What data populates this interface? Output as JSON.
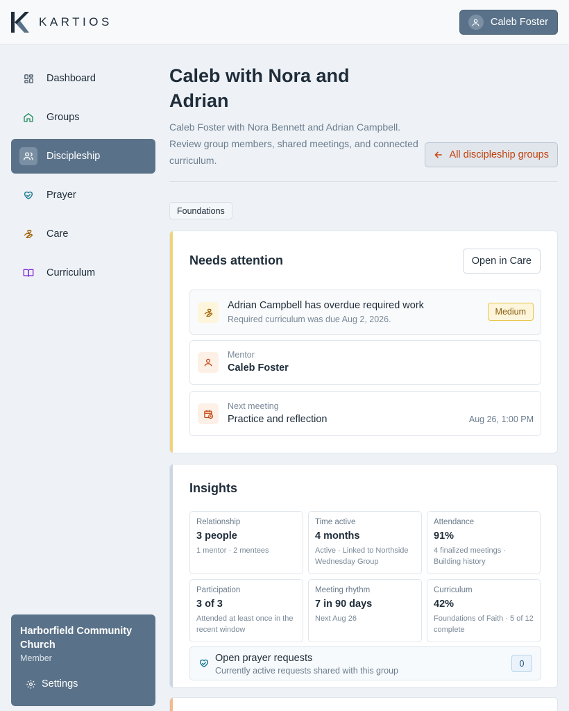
{
  "brand": {
    "name": "KARTIOS"
  },
  "user": {
    "name": "Caleb Foster"
  },
  "sidebar": {
    "items": [
      {
        "label": "Dashboard",
        "icon": "dashboard-icon"
      },
      {
        "label": "Groups",
        "icon": "home-icon"
      },
      {
        "label": "Discipleship",
        "icon": "users-icon",
        "active": true
      },
      {
        "label": "Prayer",
        "icon": "heart-hands-icon"
      },
      {
        "label": "Care",
        "icon": "hand-heart-icon"
      },
      {
        "label": "Curriculum",
        "icon": "book-icon"
      }
    ],
    "church": {
      "name": "Harborfield Community Church",
      "role": "Member",
      "settings_label": "Settings"
    }
  },
  "header": {
    "title": "Caleb with Nora and Adrian",
    "subtitle": "Caleb Foster with Nora Bennett and Adrian Campbell. Review group members, shared meetings, and connected curriculum.",
    "back_label": "All discipleship groups",
    "tag": "Foundations"
  },
  "attention": {
    "title": "Needs attention",
    "open_label": "Open in Care",
    "alert": {
      "title": "Adrian Campbell has overdue required work",
      "detail": "Required curriculum was due Aug 2, 2026.",
      "badge": "Medium"
    },
    "mentor": {
      "label": "Mentor",
      "value": "Caleb Foster"
    },
    "meeting": {
      "label": "Next meeting",
      "value": "Practice and reflection",
      "date": "Aug 26, 1:00 PM"
    }
  },
  "insights": {
    "title": "Insights",
    "tiles": [
      {
        "label": "Relationship",
        "value": "3 people",
        "detail": "1 mentor · 2 mentees"
      },
      {
        "label": "Time active",
        "value": "4 months",
        "detail": "Active · Linked to Northside Wednesday Group"
      },
      {
        "label": "Attendance",
        "value": "91%",
        "detail": "4 finalized meetings · Building history"
      },
      {
        "label": "Participation",
        "value": "3 of 3",
        "detail": "Attended at least once in the recent window"
      },
      {
        "label": "Meeting rhythm",
        "value": "7 in 90 days",
        "detail": "Next Aug 26"
      },
      {
        "label": "Curriculum",
        "value": "42%",
        "detail": "Foundations of Faith · 5 of 12 complete"
      }
    ],
    "prayer": {
      "title": "Open prayer requests",
      "detail": "Currently active requests shared with this group",
      "count": "0"
    }
  },
  "colors": {
    "accent": "#5a7289",
    "warning": "#c2410c",
    "attention_bar": "#f1d27a"
  }
}
